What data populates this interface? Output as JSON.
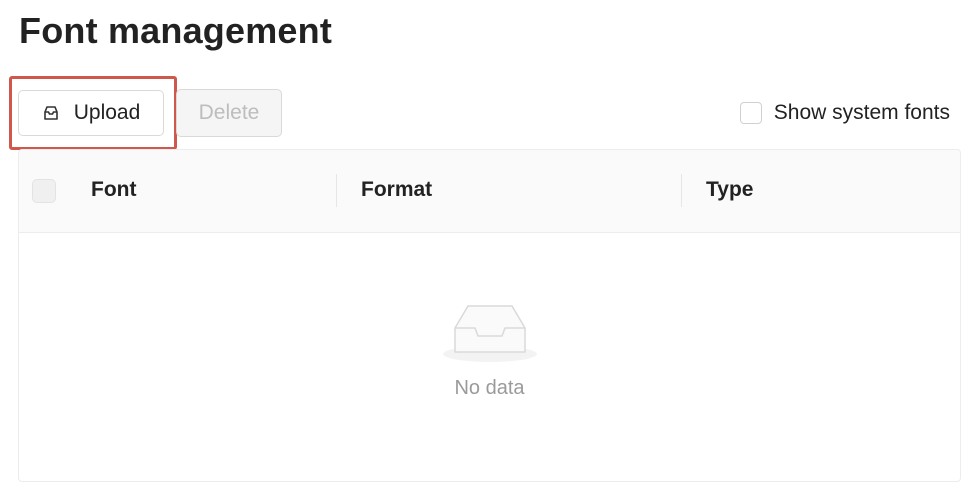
{
  "page": {
    "title": "Font management"
  },
  "toolbar": {
    "upload_label": "Upload",
    "delete_label": "Delete",
    "show_system_fonts_label": "Show system fonts",
    "show_system_fonts_checked": false
  },
  "table": {
    "columns": [
      {
        "label": "Font"
      },
      {
        "label": "Format"
      },
      {
        "label": "Type"
      }
    ],
    "rows": [],
    "empty_text": "No data"
  },
  "icons": {
    "upload": "inbox-icon",
    "empty": "empty-inbox-icon"
  },
  "colors": {
    "highlight": "#d0574c",
    "disabled_text": "#bdbdbd",
    "empty_text": "#9a9a9a"
  }
}
